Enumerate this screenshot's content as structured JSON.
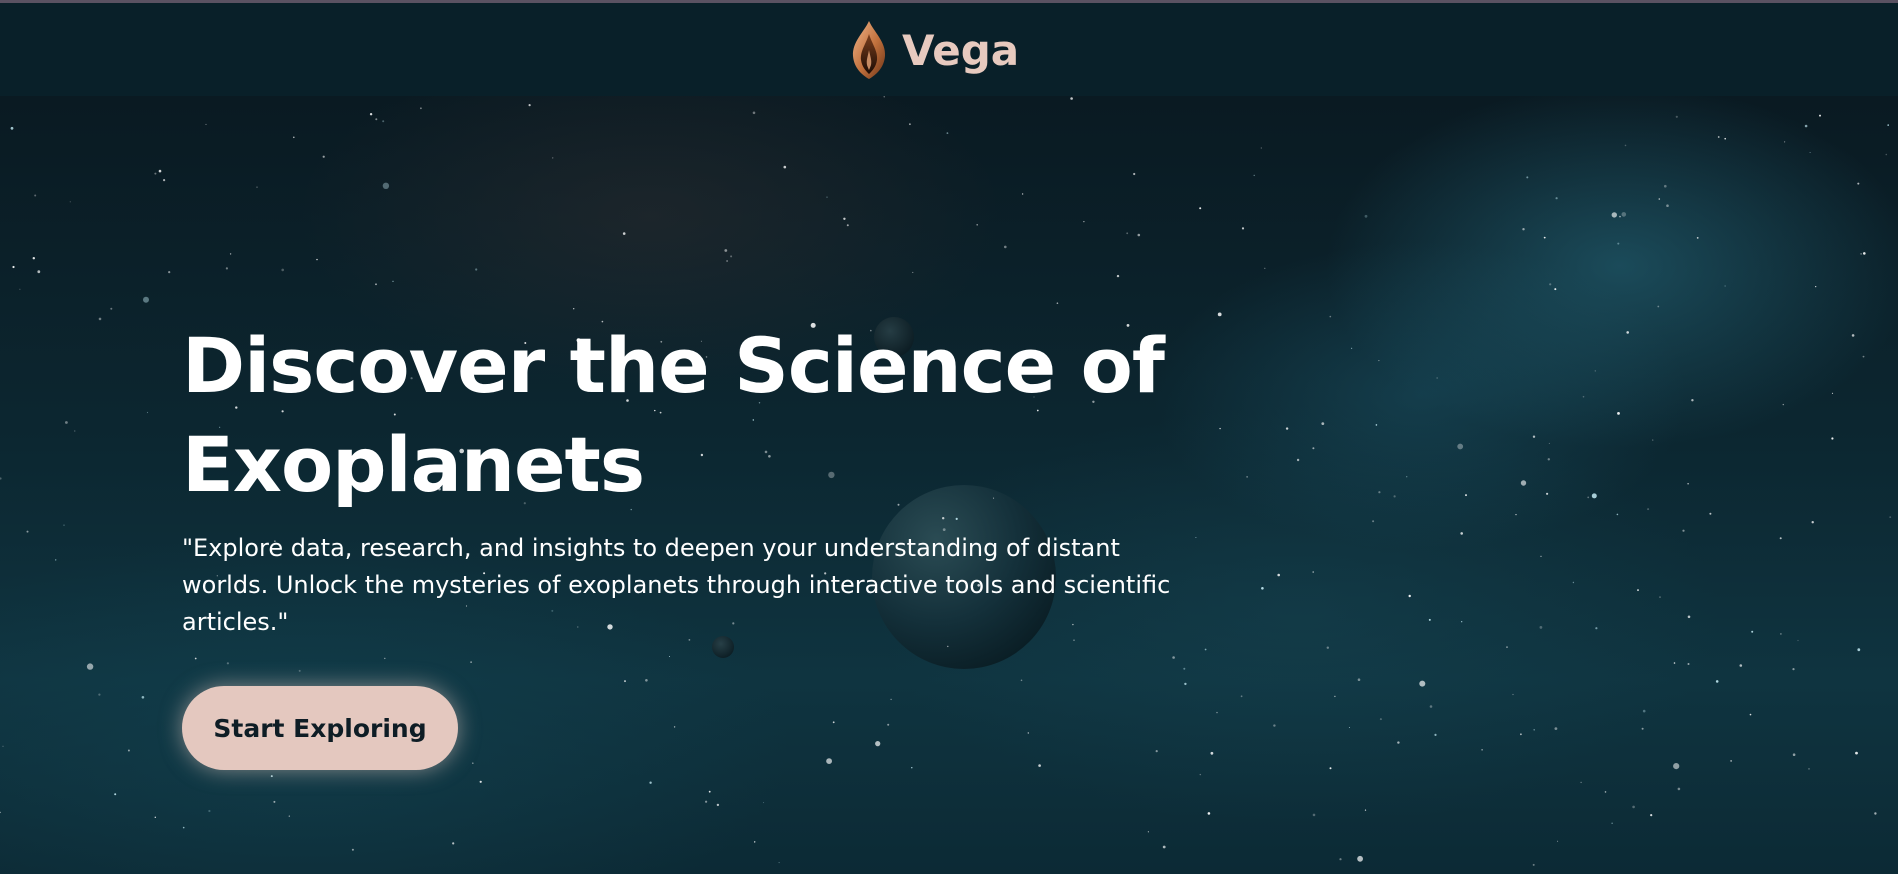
{
  "header": {
    "brand_name": "Vega",
    "logo_icon": "flame-icon"
  },
  "hero": {
    "headline": "Discover the Science of Exoplanets",
    "subtitle": "\"Explore data, research, and insights to deepen your understanding of distant worlds. Unlock the mysteries of exoplanets through interactive tools and scientific articles.\"",
    "cta_label": "Start Exploring"
  },
  "colors": {
    "header_bg": "#092029",
    "brand_text": "#e7cabf",
    "cta_bg": "#e4c8bf",
    "cta_text": "#0e1d25",
    "hero_text": "#ffffff"
  }
}
